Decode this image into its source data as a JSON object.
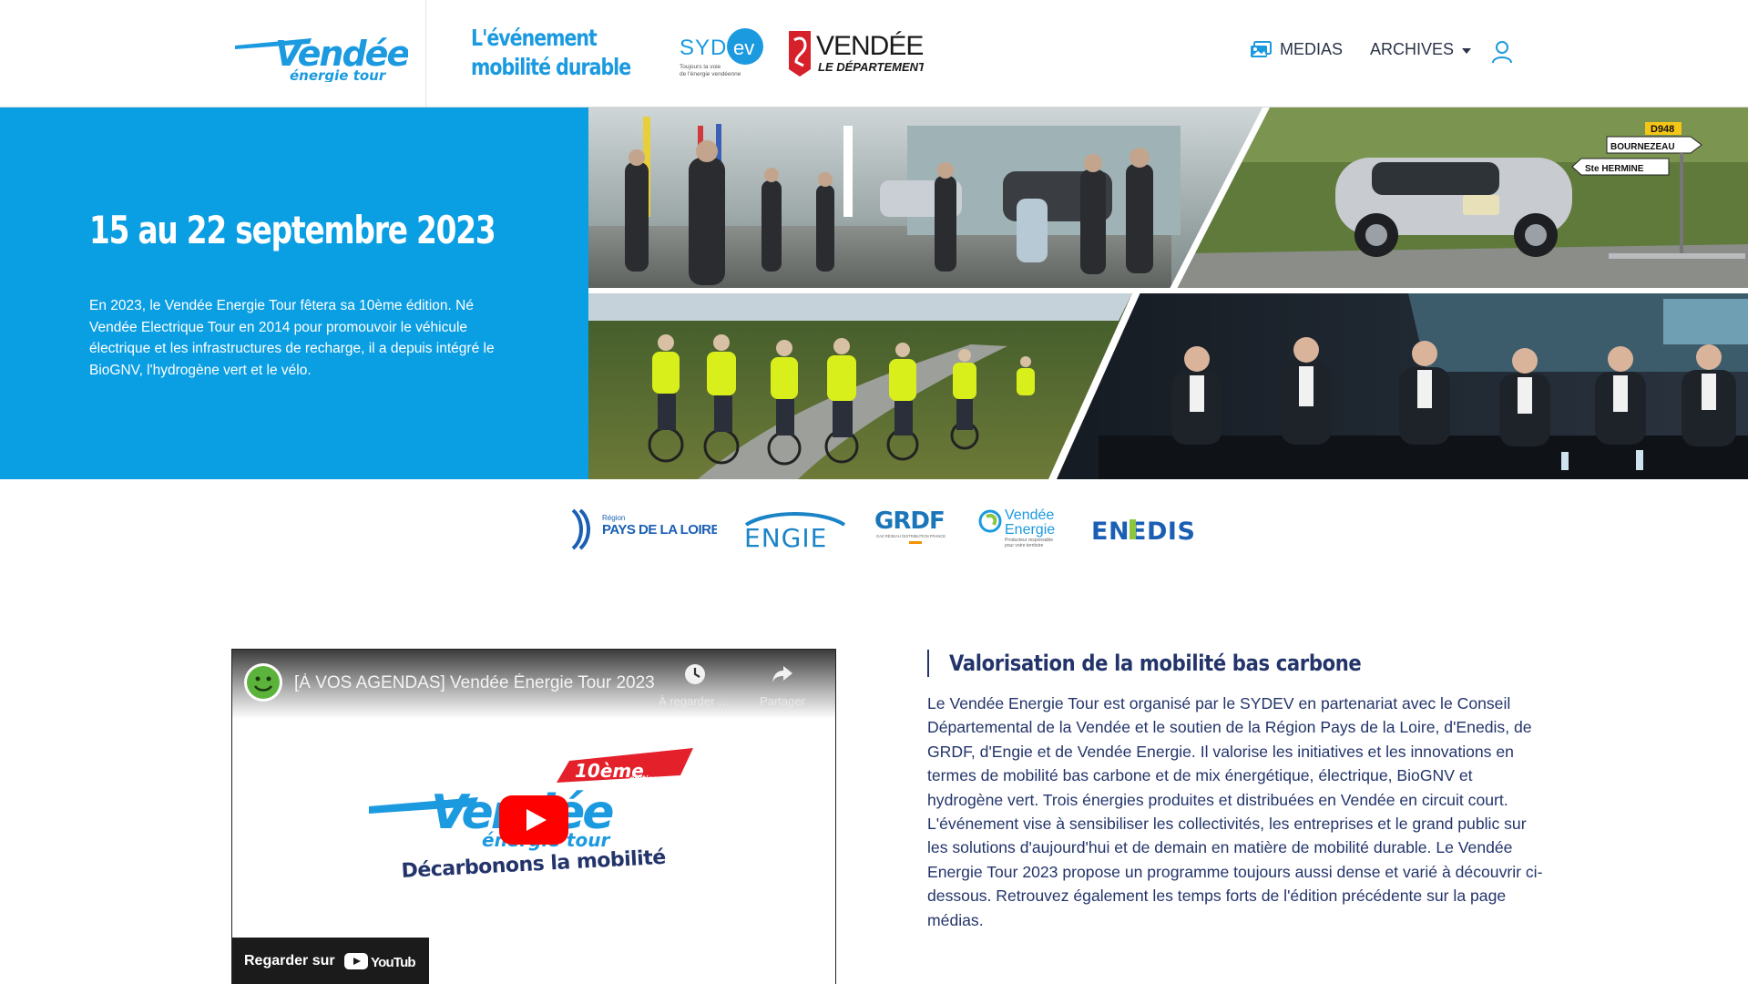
{
  "header": {
    "logo_text": "Vendée énergie tour",
    "tagline_line1": "L'événement",
    "tagline_line2": "mobilité durable",
    "sydev_text": "SYDEV",
    "sydev_caption": "Toujours la voie de l'énergie vendéenne",
    "vendee_title": "VENDÉE",
    "vendee_subtitle": "LE DÉPARTEMENT"
  },
  "nav": {
    "medias_label": "MEDIAS",
    "archives_label": "ARCHIVES"
  },
  "hero": {
    "date": "15 au 22 septembre 2023",
    "intro": "En 2023, le Vendée Energie Tour fêtera sa 10ème édition. Né Vendée Electrique Tour en 2014 pour promouvoir le véhicule électrique et les infrastructures de recharge, il a depuis intégré le BioGNV, l'hydrogène vert et le vélo.",
    "sign_road": "D948",
    "sign_town_1": "BOURNEZEAU",
    "sign_town_2": "Ste HERMINE"
  },
  "partners": [
    {
      "name": "Région Pays de la Loire",
      "label_top": "Région",
      "label_main": "PAYS DE LA LOIRE"
    },
    {
      "name": "Engie",
      "label_main": "ENGIE"
    },
    {
      "name": "GRDF",
      "label_main": "GRDF",
      "label_sub": "GAZ RÉSEAU DISTRIBUTION FRANCE"
    },
    {
      "name": "Vendée Energie",
      "label_top": "Vendée",
      "label_main": "Energie",
      "label_sub": "Producteur responsable pour votre territoire"
    },
    {
      "name": "Enedis",
      "label_main": "ENEDIS"
    }
  ],
  "video": {
    "title": "[À VOS AGENDAS] Vendée Énergie Tour 2023",
    "watch_later": "À regarder plus tard",
    "share": "Partager",
    "watch_on": "Regarder sur",
    "youtube": "YouTube",
    "badge_number": "10ème",
    "badge_edition": "édition",
    "art_brand": "Vendée",
    "art_brand_sub": "énergie tour",
    "art_slogan": "Décarbonons la mobilité"
  },
  "article": {
    "title": "Valorisation de la mobilité bas carbone",
    "body": "Le Vendée Energie Tour est organisé par le SYDEV en partenariat avec le Conseil Départemental de la Vendée et le soutien de la Région Pays de la Loire, d'Enedis, de GRDF, d'Engie et de Vendée Energie. Il valorise les initiatives et les innovations en termes de mobilité bas carbone et de mix énergétique, électrique, BioGNV et hydrogène vert. Trois énergies produites et distribuées en Vendée en circuit court. L'événement vise à sensibiliser les collectivités, les entreprises et le grand public sur les solutions d'aujourd'hui et de demain en matière de mobilité durable. Le Vendée Energie Tour 2023 propose un programme toujours aussi dense et varié à découvrir ci-dessous. Retrouvez également les temps forts de l'édition précédente sur la page médias."
  },
  "colors": {
    "brand_blue": "#0a9ee3",
    "navy": "#23346b",
    "nav_text": "#2a3347",
    "vendee_red": "#d6202a",
    "youtube_red": "#ff0000"
  }
}
